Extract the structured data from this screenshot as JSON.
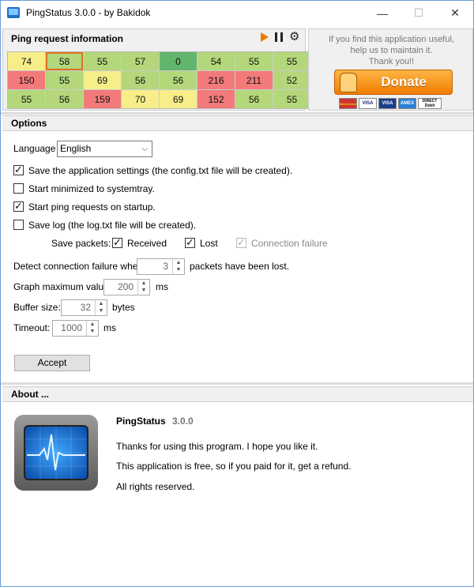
{
  "window": {
    "title": "PingStatus 3.0.0 - by Bakidok",
    "minimize_glyph": "—",
    "maximize_glyph": "☐",
    "close_glyph": "✕"
  },
  "ping_panel": {
    "title": "Ping request information",
    "cells": [
      {
        "v": "74",
        "c": "yellow"
      },
      {
        "v": "58",
        "c": "green",
        "sel": true
      },
      {
        "v": "55",
        "c": "green"
      },
      {
        "v": "57",
        "c": "green"
      },
      {
        "v": "0",
        "c": "dgreen"
      },
      {
        "v": "54",
        "c": "green"
      },
      {
        "v": "55",
        "c": "green"
      },
      {
        "v": "55",
        "c": "green"
      },
      {
        "v": "150",
        "c": "red"
      },
      {
        "v": "55",
        "c": "green"
      },
      {
        "v": "69",
        "c": "yellow"
      },
      {
        "v": "56",
        "c": "green"
      },
      {
        "v": "56",
        "c": "green"
      },
      {
        "v": "216",
        "c": "red"
      },
      {
        "v": "211",
        "c": "red"
      },
      {
        "v": "52",
        "c": "green"
      },
      {
        "v": "55",
        "c": "green"
      },
      {
        "v": "56",
        "c": "green"
      },
      {
        "v": "159",
        "c": "red"
      },
      {
        "v": "70",
        "c": "yellow"
      },
      {
        "v": "69",
        "c": "yellow"
      },
      {
        "v": "152",
        "c": "red"
      },
      {
        "v": "56",
        "c": "green"
      },
      {
        "v": "55",
        "c": "green"
      }
    ]
  },
  "donate": {
    "line1": "If you find this application useful,",
    "line2": "help us to maintain it.",
    "line3": "Thank you!!",
    "button": "Donate",
    "cards": [
      "MasterCard",
      "VISA",
      "VISA",
      "AMEX",
      "DIRECT Debit"
    ]
  },
  "options": {
    "title": "Options",
    "language_label": "Language",
    "language_value": "English",
    "save_settings": "Save the application settings (the config.txt file will be created).",
    "start_minimized": "Start minimized to systemtray.",
    "start_ping": "Start ping requests on startup.",
    "save_log": "Save log (the log.txt file will be created).",
    "save_packets_label": "Save packets:",
    "received": "Received",
    "lost": "Lost",
    "connection_failure": "Connection failure",
    "detect_label": "Detect connection failure when",
    "detect_value": "3",
    "detect_suffix": "packets have been lost.",
    "graph_label": "Graph maximum value:",
    "graph_value": "200",
    "graph_unit": "ms",
    "buffer_label": "Buffer size:",
    "buffer_value": "32",
    "buffer_unit": "bytes",
    "timeout_label": "Timeout:",
    "timeout_value": "1000",
    "timeout_unit": "ms",
    "accept": "Accept"
  },
  "about": {
    "title": "About ...",
    "name": "PingStatus",
    "version": "3.0.0",
    "line1": "Thanks for using this program. I hope you like it.",
    "line2": "This application is free, so if you paid for it, get a refund.",
    "line3": "All rights reserved."
  }
}
